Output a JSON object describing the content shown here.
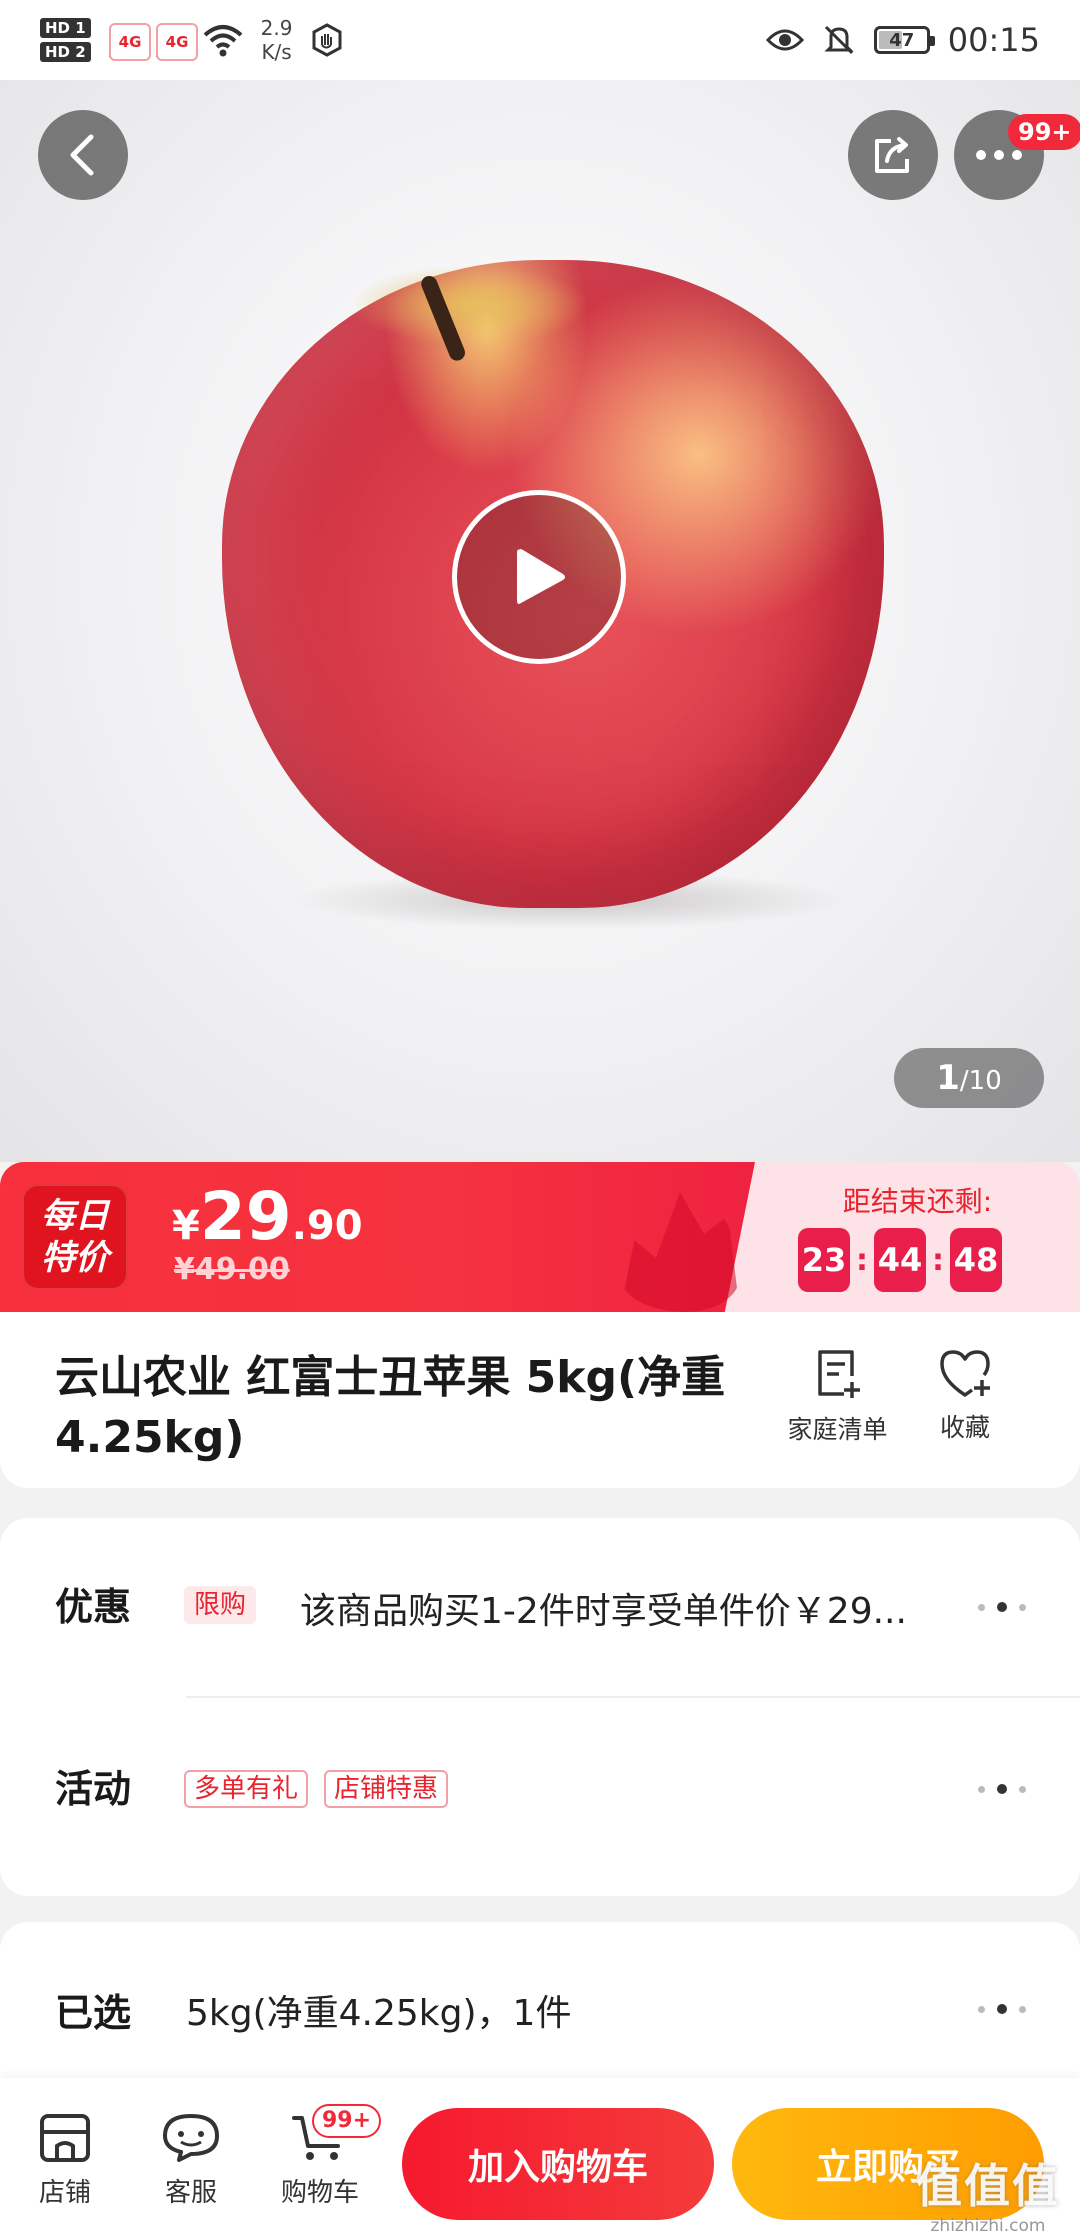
{
  "status_bar": {
    "network": "4G",
    "hd": [
      "HD 1",
      "HD 2"
    ],
    "speed_value": "2.9",
    "speed_unit": "K/s",
    "battery": "47",
    "time": "00:15",
    "icons": [
      "hd-icon",
      "signal-icon",
      "wifi-icon",
      "hand-icon",
      "eye-icon",
      "bell-off-icon",
      "battery-icon"
    ]
  },
  "hero": {
    "more_badge": "99+",
    "image_counter": {
      "current": "1",
      "total": "/10"
    },
    "icons": [
      "back-arrow-icon",
      "share-icon",
      "more-dots-icon",
      "play-icon"
    ]
  },
  "price_bar": {
    "badge_line1": "每日",
    "badge_line2": "特价",
    "currency": "¥",
    "price_int": "29",
    "price_dec": ".90",
    "original_price": "¥49.00",
    "countdown_label": "距结束还剩:",
    "countdown": {
      "hours": "23",
      "minutes": "44",
      "seconds": "48"
    }
  },
  "product": {
    "title": "云山农业 红富士丑苹果 5kg(净重4.25kg)",
    "family_list_label": "家庭清单",
    "favorite_label": "收藏"
  },
  "promotions": {
    "label": "优惠",
    "tag": "限购",
    "text": "该商品购买1-2件时享受单件价￥29..."
  },
  "activities": {
    "label": "活动",
    "tags": [
      "多单有礼",
      "店铺特惠"
    ]
  },
  "selected": {
    "label": "已选",
    "text": "5kg(净重4.25kg)，1件"
  },
  "bottom_bar": {
    "shop_label": "店铺",
    "service_label": "客服",
    "cart_label": "购物车",
    "cart_badge": "99+",
    "add_to_cart": "加入购物车",
    "buy_now": "立即购买"
  },
  "watermark": {
    "main": "值值值",
    "sub": "zhizhizhi.com"
  },
  "colors": {
    "brand_red": "#f5323f",
    "countdown_pink": "#ea1e4a",
    "buy_orange": "#ffa100"
  }
}
